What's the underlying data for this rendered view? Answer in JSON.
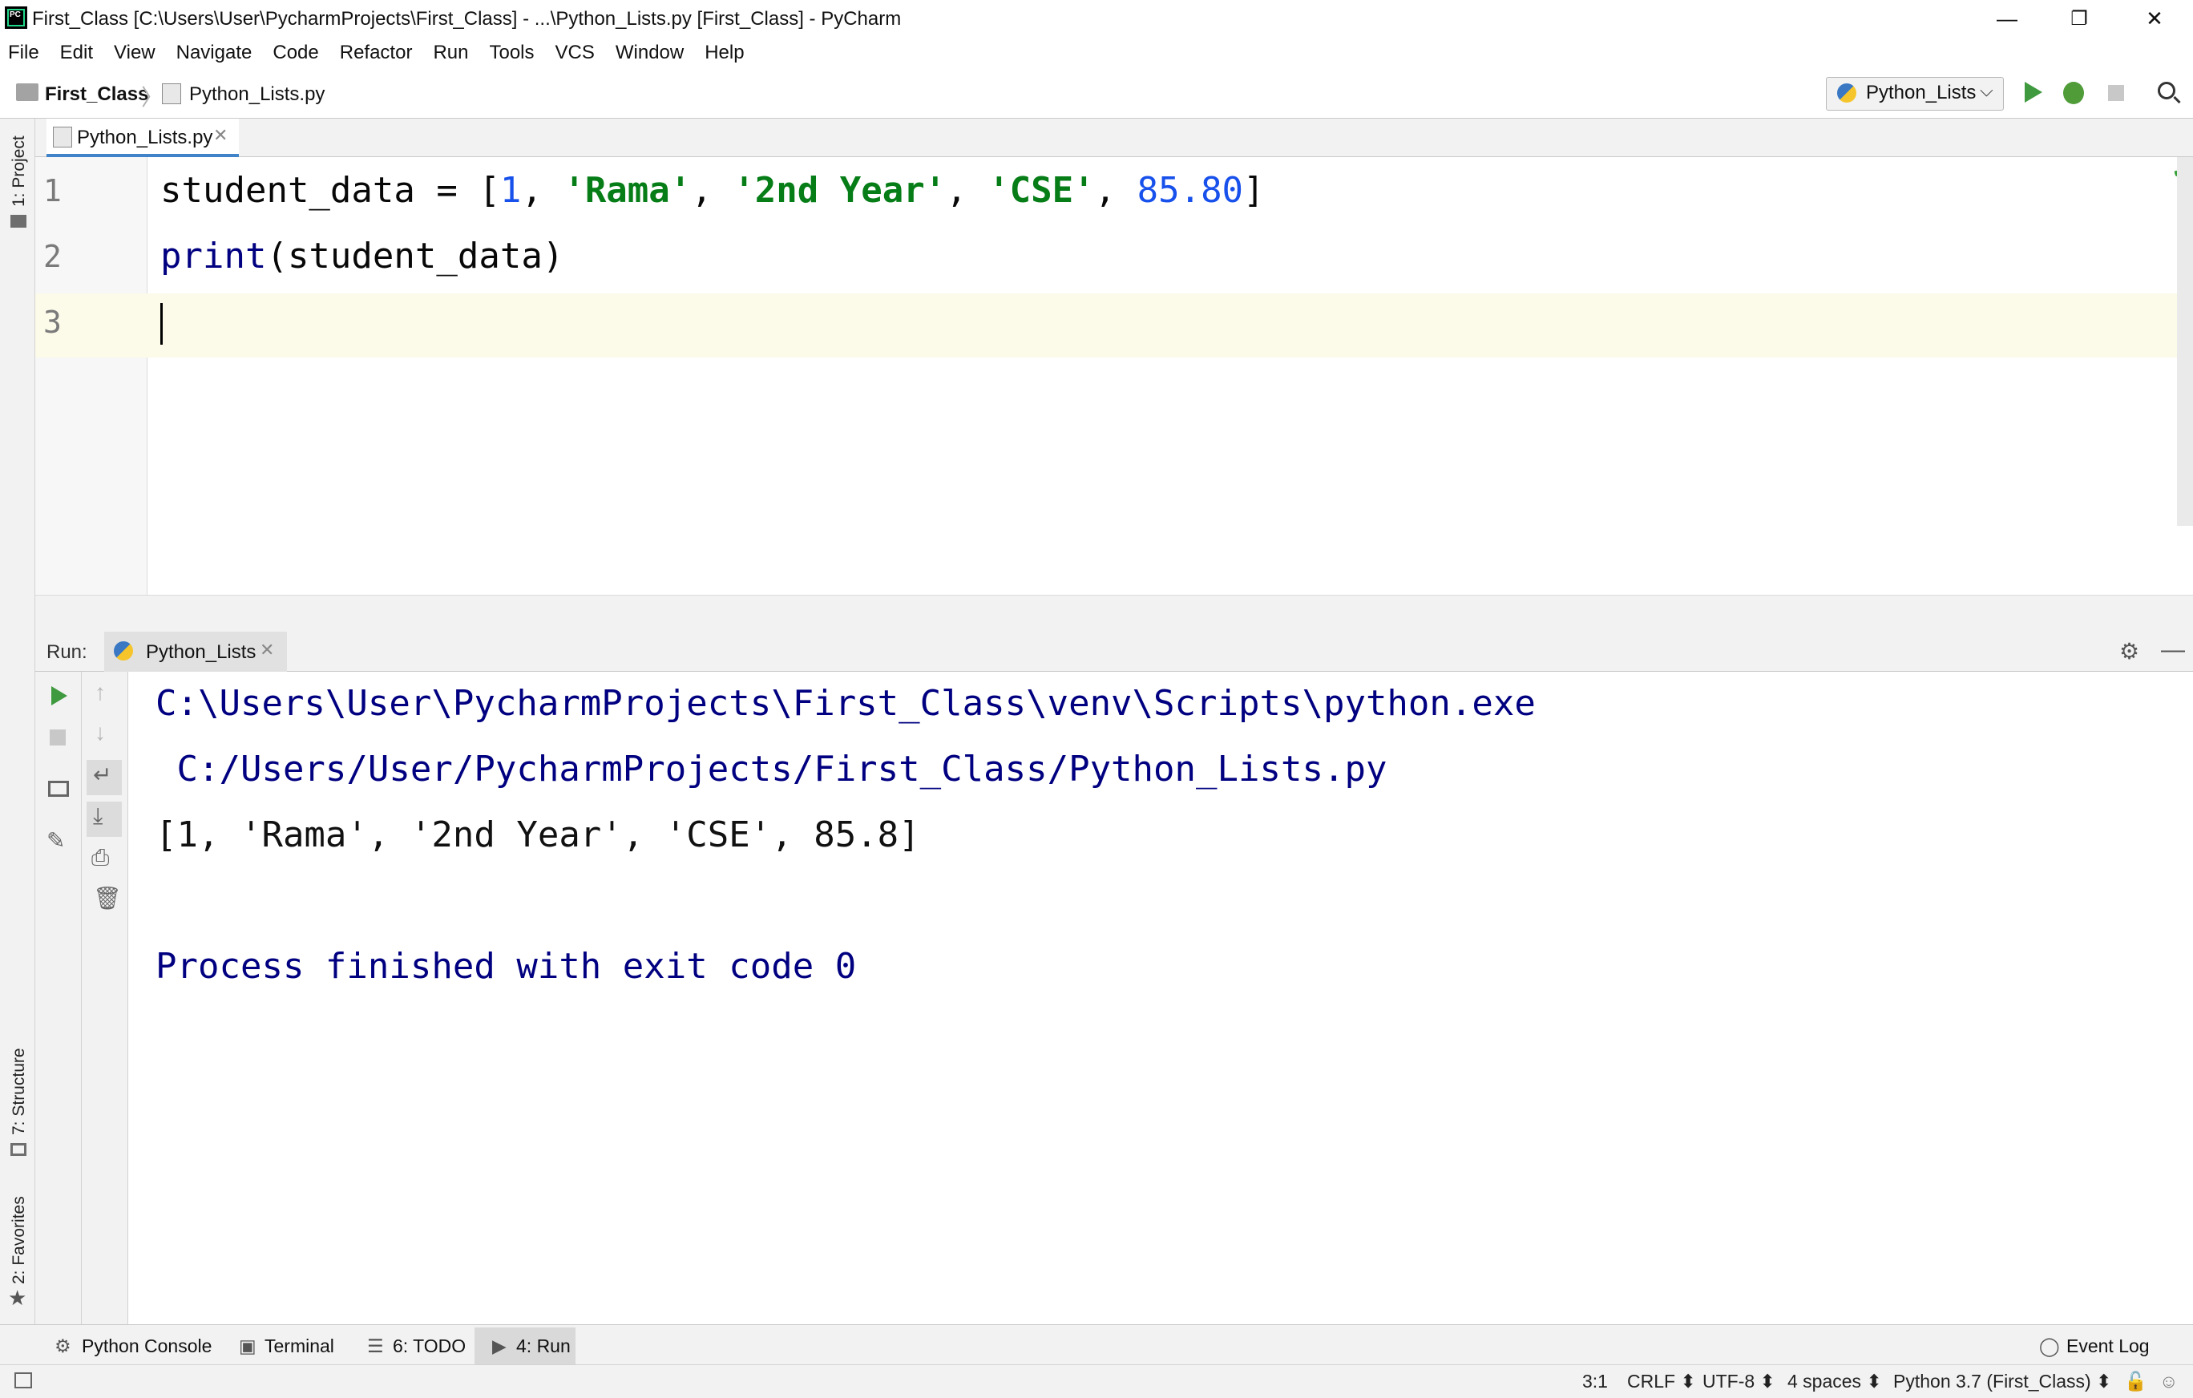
{
  "window": {
    "title": "First_Class [C:\\Users\\User\\PycharmProjects\\First_Class] - ...\\Python_Lists.py [First_Class] - PyCharm",
    "minimize": "—",
    "restore": "❐",
    "close": "✕"
  },
  "menu": [
    "File",
    "Edit",
    "View",
    "Navigate",
    "Code",
    "Refactor",
    "Run",
    "Tools",
    "VCS",
    "Window",
    "Help"
  ],
  "navbar": {
    "project": "First_Class",
    "separator": "〉",
    "file": "Python_Lists.py",
    "run_config": "Python_Lists"
  },
  "side_tools": {
    "project": "1: Project",
    "structure": "7: Structure",
    "favorites": "2: Favorites"
  },
  "editor": {
    "tab_label": "Python_Lists.py",
    "tab_close": "✕",
    "line_numbers": [
      "1",
      "2",
      "3"
    ],
    "line1": {
      "var": "student_data = [",
      "n1": "1",
      "c1": ", ",
      "s1": "'Rama'",
      "c2": ", ",
      "s2": "'2nd Year'",
      "c3": ", ",
      "s3": "'CSE'",
      "c4": ", ",
      "n2": "85.80",
      "end": "]"
    },
    "line2": {
      "fn": "print",
      "args": "(student_data)"
    }
  },
  "run_panel": {
    "label": "Run:",
    "tab_label": "Python_Lists",
    "tab_close": "✕",
    "output": [
      "C:\\Users\\User\\PycharmProjects\\First_Class\\venv\\Scripts\\python.exe",
      " C:/Users/User/PycharmProjects/First_Class/Python_Lists.py",
      "[1, 'Rama', '2nd Year', 'CSE', 85.8]",
      "Process finished with exit code 0"
    ]
  },
  "bottom_tools": {
    "python_console": "Python Console",
    "terminal": "Terminal",
    "todo": "6: TODO",
    "run": "4: Run",
    "event_log": "Event Log"
  },
  "status": {
    "position": "3:1",
    "line_sep": "CRLF ⬍",
    "encoding": "UTF-8 ⬍",
    "indent": "4 spaces ⬍",
    "interpreter": "Python 3.7 (First_Class) ⬍"
  }
}
